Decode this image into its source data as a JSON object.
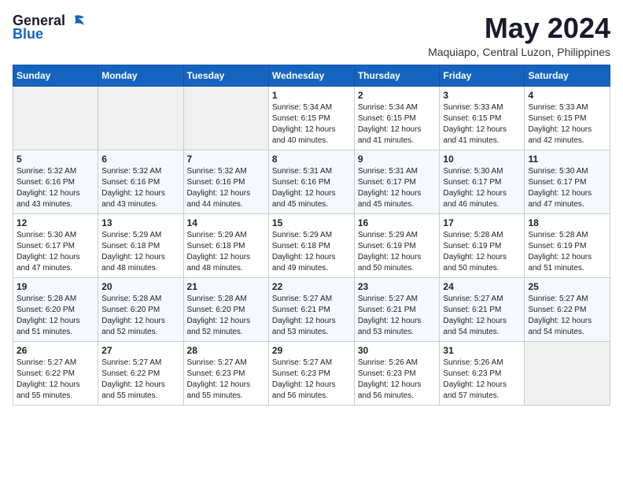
{
  "logo": {
    "general": "General",
    "blue": "Blue"
  },
  "title": {
    "month_year": "May 2024",
    "location": "Maquiapo, Central Luzon, Philippines"
  },
  "calendar": {
    "headers": [
      "Sunday",
      "Monday",
      "Tuesday",
      "Wednesday",
      "Thursday",
      "Friday",
      "Saturday"
    ],
    "weeks": [
      [
        {
          "day": "",
          "info": ""
        },
        {
          "day": "",
          "info": ""
        },
        {
          "day": "",
          "info": ""
        },
        {
          "day": "1",
          "info": "Sunrise: 5:34 AM\nSunset: 6:15 PM\nDaylight: 12 hours\nand 40 minutes."
        },
        {
          "day": "2",
          "info": "Sunrise: 5:34 AM\nSunset: 6:15 PM\nDaylight: 12 hours\nand 41 minutes."
        },
        {
          "day": "3",
          "info": "Sunrise: 5:33 AM\nSunset: 6:15 PM\nDaylight: 12 hours\nand 41 minutes."
        },
        {
          "day": "4",
          "info": "Sunrise: 5:33 AM\nSunset: 6:15 PM\nDaylight: 12 hours\nand 42 minutes."
        }
      ],
      [
        {
          "day": "5",
          "info": "Sunrise: 5:32 AM\nSunset: 6:16 PM\nDaylight: 12 hours\nand 43 minutes."
        },
        {
          "day": "6",
          "info": "Sunrise: 5:32 AM\nSunset: 6:16 PM\nDaylight: 12 hours\nand 43 minutes."
        },
        {
          "day": "7",
          "info": "Sunrise: 5:32 AM\nSunset: 6:16 PM\nDaylight: 12 hours\nand 44 minutes."
        },
        {
          "day": "8",
          "info": "Sunrise: 5:31 AM\nSunset: 6:16 PM\nDaylight: 12 hours\nand 45 minutes."
        },
        {
          "day": "9",
          "info": "Sunrise: 5:31 AM\nSunset: 6:17 PM\nDaylight: 12 hours\nand 45 minutes."
        },
        {
          "day": "10",
          "info": "Sunrise: 5:30 AM\nSunset: 6:17 PM\nDaylight: 12 hours\nand 46 minutes."
        },
        {
          "day": "11",
          "info": "Sunrise: 5:30 AM\nSunset: 6:17 PM\nDaylight: 12 hours\nand 47 minutes."
        }
      ],
      [
        {
          "day": "12",
          "info": "Sunrise: 5:30 AM\nSunset: 6:17 PM\nDaylight: 12 hours\nand 47 minutes."
        },
        {
          "day": "13",
          "info": "Sunrise: 5:29 AM\nSunset: 6:18 PM\nDaylight: 12 hours\nand 48 minutes."
        },
        {
          "day": "14",
          "info": "Sunrise: 5:29 AM\nSunset: 6:18 PM\nDaylight: 12 hours\nand 48 minutes."
        },
        {
          "day": "15",
          "info": "Sunrise: 5:29 AM\nSunset: 6:18 PM\nDaylight: 12 hours\nand 49 minutes."
        },
        {
          "day": "16",
          "info": "Sunrise: 5:29 AM\nSunset: 6:19 PM\nDaylight: 12 hours\nand 50 minutes."
        },
        {
          "day": "17",
          "info": "Sunrise: 5:28 AM\nSunset: 6:19 PM\nDaylight: 12 hours\nand 50 minutes."
        },
        {
          "day": "18",
          "info": "Sunrise: 5:28 AM\nSunset: 6:19 PM\nDaylight: 12 hours\nand 51 minutes."
        }
      ],
      [
        {
          "day": "19",
          "info": "Sunrise: 5:28 AM\nSunset: 6:20 PM\nDaylight: 12 hours\nand 51 minutes."
        },
        {
          "day": "20",
          "info": "Sunrise: 5:28 AM\nSunset: 6:20 PM\nDaylight: 12 hours\nand 52 minutes."
        },
        {
          "day": "21",
          "info": "Sunrise: 5:28 AM\nSunset: 6:20 PM\nDaylight: 12 hours\nand 52 minutes."
        },
        {
          "day": "22",
          "info": "Sunrise: 5:27 AM\nSunset: 6:21 PM\nDaylight: 12 hours\nand 53 minutes."
        },
        {
          "day": "23",
          "info": "Sunrise: 5:27 AM\nSunset: 6:21 PM\nDaylight: 12 hours\nand 53 minutes."
        },
        {
          "day": "24",
          "info": "Sunrise: 5:27 AM\nSunset: 6:21 PM\nDaylight: 12 hours\nand 54 minutes."
        },
        {
          "day": "25",
          "info": "Sunrise: 5:27 AM\nSunset: 6:22 PM\nDaylight: 12 hours\nand 54 minutes."
        }
      ],
      [
        {
          "day": "26",
          "info": "Sunrise: 5:27 AM\nSunset: 6:22 PM\nDaylight: 12 hours\nand 55 minutes."
        },
        {
          "day": "27",
          "info": "Sunrise: 5:27 AM\nSunset: 6:22 PM\nDaylight: 12 hours\nand 55 minutes."
        },
        {
          "day": "28",
          "info": "Sunrise: 5:27 AM\nSunset: 6:23 PM\nDaylight: 12 hours\nand 55 minutes."
        },
        {
          "day": "29",
          "info": "Sunrise: 5:27 AM\nSunset: 6:23 PM\nDaylight: 12 hours\nand 56 minutes."
        },
        {
          "day": "30",
          "info": "Sunrise: 5:26 AM\nSunset: 6:23 PM\nDaylight: 12 hours\nand 56 minutes."
        },
        {
          "day": "31",
          "info": "Sunrise: 5:26 AM\nSunset: 6:23 PM\nDaylight: 12 hours\nand 57 minutes."
        },
        {
          "day": "",
          "info": ""
        }
      ]
    ]
  }
}
